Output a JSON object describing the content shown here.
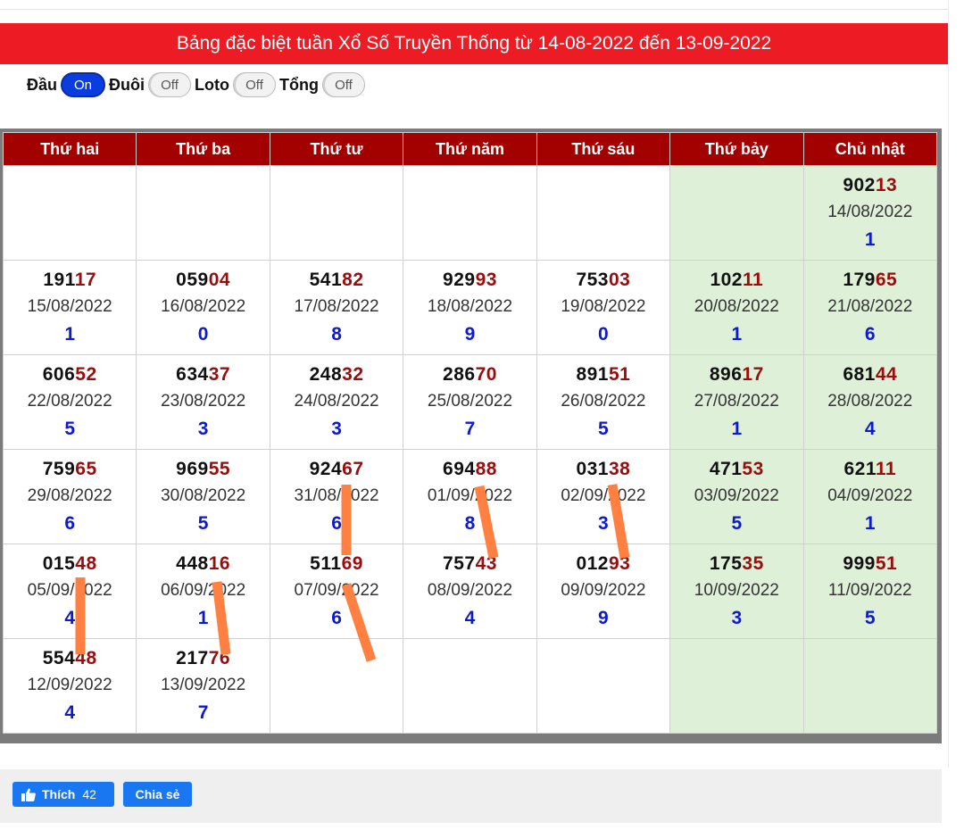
{
  "title": "Bảng đặc biệt tuần Xổ Số Truyền Thống từ 14-08-2022 đến 13-09-2022",
  "toggles": [
    {
      "label": "Đầu",
      "state": "On"
    },
    {
      "label": "Đuôi",
      "state": "Off"
    },
    {
      "label": "Loto",
      "state": "Off"
    },
    {
      "label": "Tổng",
      "state": "Off"
    }
  ],
  "days": [
    "Thứ hai",
    "Thứ ba",
    "Thứ tư",
    "Thứ năm",
    "Thứ sáu",
    "Thứ bảy",
    "Chủ nhật"
  ],
  "weeks": [
    [
      null,
      null,
      null,
      null,
      null,
      null,
      {
        "head": "902",
        "tail": "13",
        "date": "14/08/2022",
        "sum": "1"
      }
    ],
    [
      {
        "head": "191",
        "tail": "17",
        "date": "15/08/2022",
        "sum": "1"
      },
      {
        "head": "059",
        "tail": "04",
        "date": "16/08/2022",
        "sum": "0"
      },
      {
        "head": "541",
        "tail": "82",
        "date": "17/08/2022",
        "sum": "8"
      },
      {
        "head": "929",
        "tail": "93",
        "date": "18/08/2022",
        "sum": "9"
      },
      {
        "head": "753",
        "tail": "03",
        "date": "19/08/2022",
        "sum": "0"
      },
      {
        "head": "102",
        "tail": "11",
        "date": "20/08/2022",
        "sum": "1"
      },
      {
        "head": "179",
        "tail": "65",
        "date": "21/08/2022",
        "sum": "6"
      }
    ],
    [
      {
        "head": "606",
        "tail": "52",
        "date": "22/08/2022",
        "sum": "5"
      },
      {
        "head": "634",
        "tail": "37",
        "date": "23/08/2022",
        "sum": "3"
      },
      {
        "head": "248",
        "tail": "32",
        "date": "24/08/2022",
        "sum": "3"
      },
      {
        "head": "286",
        "tail": "70",
        "date": "25/08/2022",
        "sum": "7"
      },
      {
        "head": "891",
        "tail": "51",
        "date": "26/08/2022",
        "sum": "5"
      },
      {
        "head": "896",
        "tail": "17",
        "date": "27/08/2022",
        "sum": "1"
      },
      {
        "head": "681",
        "tail": "44",
        "date": "28/08/2022",
        "sum": "4"
      }
    ],
    [
      {
        "head": "759",
        "tail": "65",
        "date": "29/08/2022",
        "sum": "6"
      },
      {
        "head": "969",
        "tail": "55",
        "date": "30/08/2022",
        "sum": "5"
      },
      {
        "head": "924",
        "tail": "67",
        "date": "31/08/2022",
        "sum": "6"
      },
      {
        "head": "694",
        "tail": "88",
        "date": "01/09/2022",
        "sum": "8"
      },
      {
        "head": "031",
        "tail": "38",
        "date": "02/09/2022",
        "sum": "3"
      },
      {
        "head": "471",
        "tail": "53",
        "date": "03/09/2022",
        "sum": "5"
      },
      {
        "head": "621",
        "tail": "11",
        "date": "04/09/2022",
        "sum": "1"
      }
    ],
    [
      {
        "head": "015",
        "tail": "48",
        "date": "05/09/2022",
        "sum": "4"
      },
      {
        "head": "448",
        "tail": "16",
        "date": "06/09/2022",
        "sum": "1"
      },
      {
        "head": "511",
        "tail": "69",
        "date": "07/09/2022",
        "sum": "6"
      },
      {
        "head": "757",
        "tail": "43",
        "date": "08/09/2022",
        "sum": "4"
      },
      {
        "head": "012",
        "tail": "93",
        "date": "09/09/2022",
        "sum": "9"
      },
      {
        "head": "175",
        "tail": "35",
        "date": "10/09/2022",
        "sum": "3"
      },
      {
        "head": "999",
        "tail": "51",
        "date": "11/09/2022",
        "sum": "5"
      }
    ],
    [
      {
        "head": "554",
        "tail": "48",
        "date": "12/09/2022",
        "sum": "4"
      },
      {
        "head": "217",
        "tail": "76",
        "date": "13/09/2022",
        "sum": "7"
      },
      null,
      null,
      null,
      null,
      null
    ]
  ],
  "colors": {
    "title_bg": "#ed1c24",
    "header_bg": "#a30000",
    "weekend_bg": "#dff0d8",
    "tail": "#9b0c0c",
    "sum": "#0d1ad0",
    "annotation": "#ff8040",
    "fb_blue": "#1a77f2"
  },
  "footer": {
    "like_label": "Thích",
    "like_count": "42",
    "share_label": "Chia sẻ"
  }
}
